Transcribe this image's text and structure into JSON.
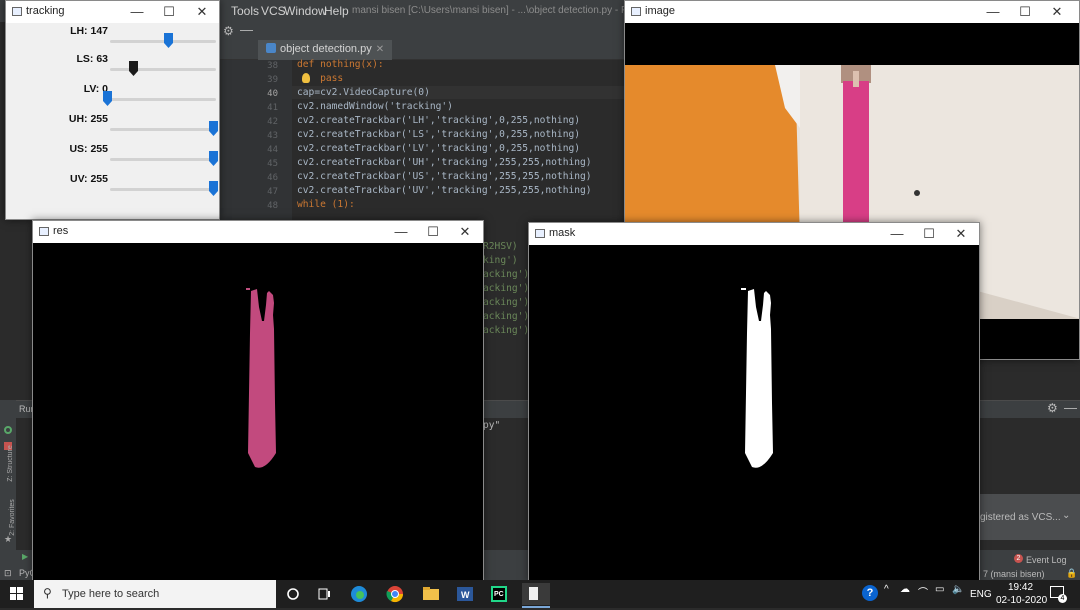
{
  "ide": {
    "menu": [
      "Tools",
      "VCS",
      "Window",
      "Help"
    ],
    "title_path": "mansi bisen [C:\\Users\\mansi bisen] - ...\\object detection.py - PyCharm",
    "tab_label": "object detection.py",
    "line_numbers": [
      "38",
      "39",
      "40",
      "41",
      "42",
      "43",
      "44",
      "45",
      "46",
      "47",
      "48"
    ],
    "code_lines": [
      "def nothing(x):",
      "    pass",
      "cap=cv2.VideoCapture(0)",
      "cv2.namedWindow('tracking')",
      "cv2.createTrackbar('LH','tracking',0,255,nothing)",
      "cv2.createTrackbar('LS','tracking',0,255,nothing)",
      "cv2.createTrackbar('LV','tracking',0,255,nothing)",
      "cv2.createTrackbar('UH','tracking',255,255,nothing)",
      "cv2.createTrackbar('US','tracking',255,255,nothing)",
      "cv2.createTrackbar('UV','tracking',255,255,nothing)",
      "while (1):"
    ],
    "hidden_fragments": [
      "R2HSV)",
      "king')",
      "acking')",
      "acking')",
      "acking')",
      "acking')",
      "acking')"
    ],
    "run_label": "Run",
    "run_output_fragment": "py\"",
    "left_tabs": [
      "Z: Structure",
      "2: Favorites"
    ],
    "notification_text": "gistered as VCS...",
    "event_log": "Event Log",
    "event_badge": "2",
    "status_left": "PyC",
    "status_right": "7 (mansi bisen)"
  },
  "windows": {
    "tracking": {
      "title": "tracking",
      "trackbars": [
        {
          "label": "LH: 147",
          "value": 147,
          "max": 255,
          "color": "#1a73d6"
        },
        {
          "label": "LS: 63",
          "value": 63,
          "max": 255,
          "color": "#1b1b1b"
        },
        {
          "label": "LV: 0",
          "value": 0,
          "max": 255,
          "color": "#1a73d6"
        },
        {
          "label": "UH: 255",
          "value": 255,
          "max": 255,
          "color": "#1a73d6"
        },
        {
          "label": "US: 255",
          "value": 255,
          "max": 255,
          "color": "#1a73d6"
        },
        {
          "label": "UV: 255",
          "value": 255,
          "max": 255,
          "color": "#1a73d6"
        }
      ]
    },
    "image": {
      "title": "image"
    },
    "res": {
      "title": "res"
    },
    "mask": {
      "title": "mask"
    }
  },
  "taskbar": {
    "search_placeholder": "Type here to search",
    "language": "ENG",
    "time": "19:42",
    "date": "02-10-2020",
    "notification_count": "4"
  }
}
